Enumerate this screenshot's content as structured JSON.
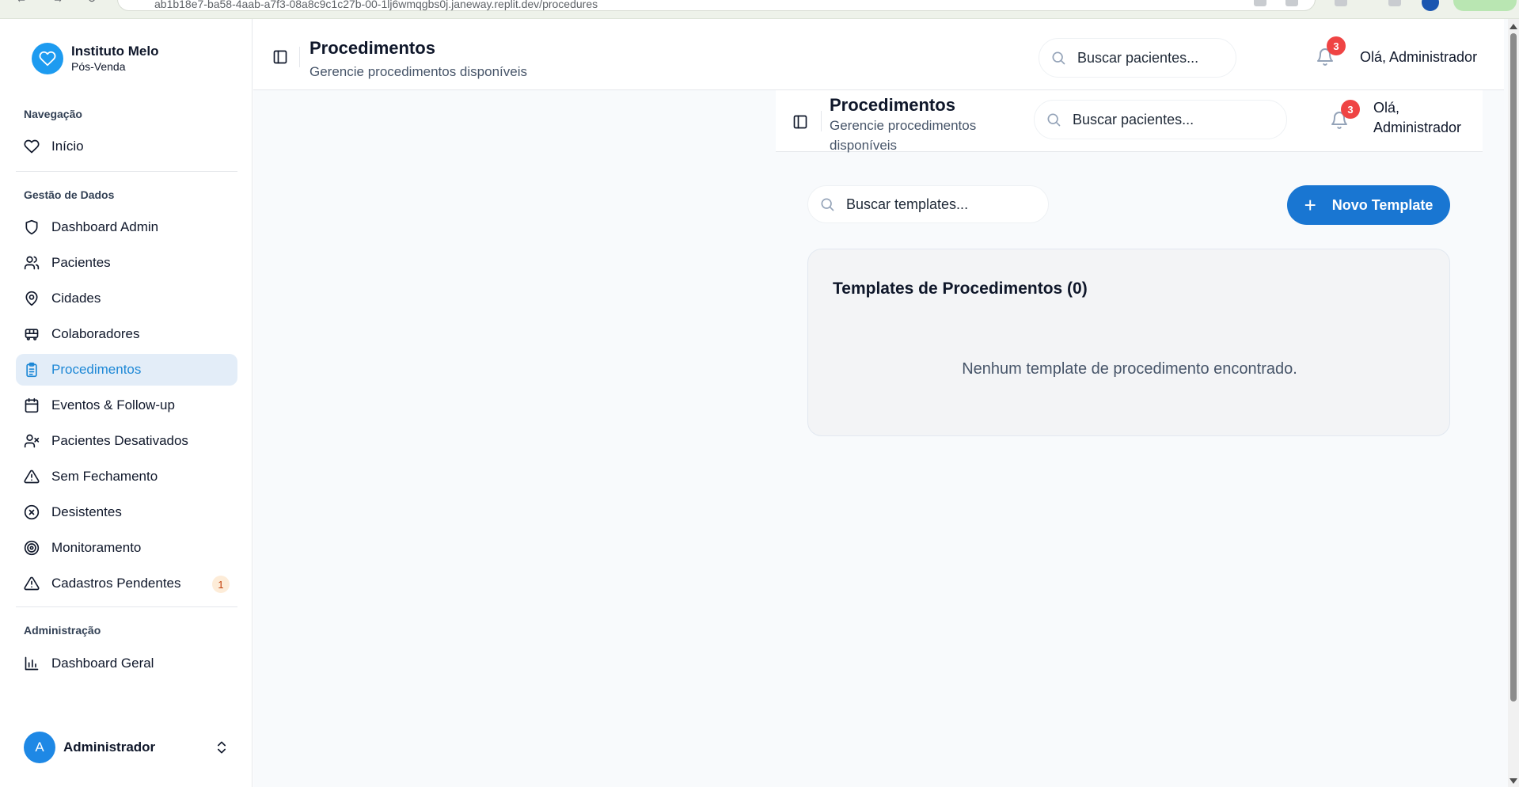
{
  "browser": {
    "url_fragment": "ab1b18e7-ba58-4aab-a7f3-08a8c9c1c27b-00-1lj6wmqgbs0j.janeway.replit.dev/procedures"
  },
  "brand": {
    "name": "Instituto Melo",
    "subtitle": "Pós-Venda",
    "logo_icon": "heart-icon"
  },
  "sidebar": {
    "sections": [
      {
        "label": "Navegação"
      },
      {
        "label": "Gestão de Dados"
      },
      {
        "label": "Administração"
      }
    ],
    "items": [
      {
        "label": "Início",
        "icon": "heart-icon"
      },
      {
        "label": "Dashboard Admin",
        "icon": "shield-icon"
      },
      {
        "label": "Pacientes",
        "icon": "users-icon"
      },
      {
        "label": "Cidades",
        "icon": "map-pin-icon"
      },
      {
        "label": "Colaboradores",
        "icon": "bus-icon"
      },
      {
        "label": "Procedimentos",
        "icon": "clipboard-icon",
        "active": true
      },
      {
        "label": "Eventos & Follow-up",
        "icon": "calendar-icon"
      },
      {
        "label": "Pacientes Desativados",
        "icon": "user-x-icon"
      },
      {
        "label": "Sem Fechamento",
        "icon": "alert-triangle-icon"
      },
      {
        "label": "Desistentes",
        "icon": "x-circle-icon"
      },
      {
        "label": "Monitoramento",
        "icon": "target-icon"
      },
      {
        "label": "Cadastros Pendentes",
        "icon": "alert-triangle-icon",
        "badge": "1"
      },
      {
        "label": "Dashboard Geral",
        "icon": "bar-chart-icon"
      }
    ],
    "user": {
      "initial": "A",
      "name": "Administrador"
    }
  },
  "header": {
    "title": "Procedimentos",
    "subtitle": "Gerencie procedimentos disponíveis",
    "search_placeholder": "Buscar pacientes...",
    "notifications_count": "3",
    "greeting": "Olá, Administrador"
  },
  "content": {
    "search_placeholder": "Buscar templates...",
    "new_button_label": "Novo Template",
    "card_title": "Templates de Procedimentos (0)",
    "empty_message": "Nenhum template de procedimento encontrado."
  },
  "colors": {
    "accent": "#1976d2",
    "active_nav_bg": "#e3edf8",
    "active_nav_text": "#1e88d6",
    "notification_badge": "#ef4444",
    "pending_badge_bg": "#fdecd8"
  }
}
